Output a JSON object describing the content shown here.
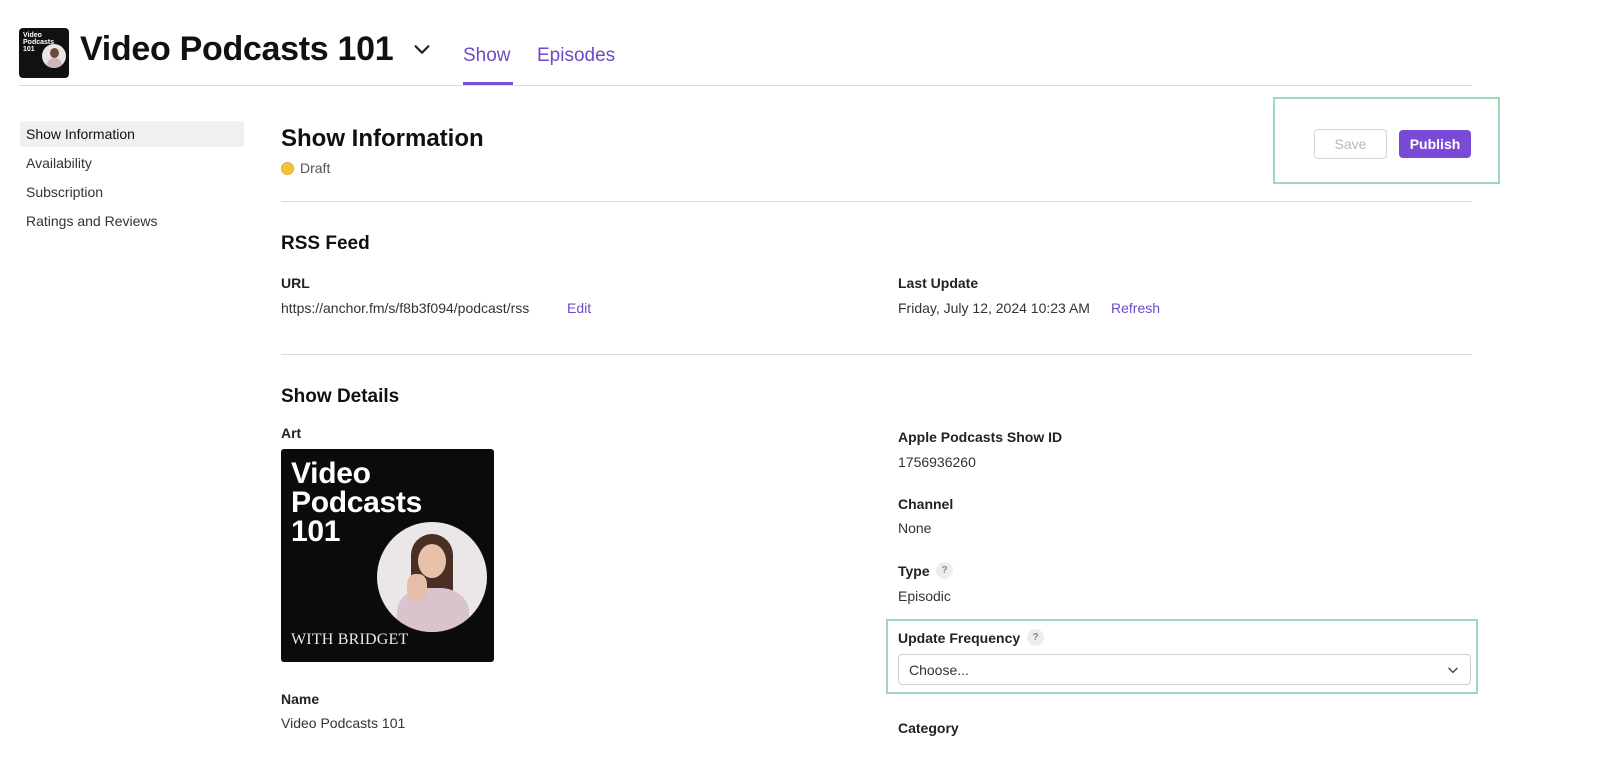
{
  "header": {
    "logo_text": "Video Podcasts 101",
    "show_title": "Video Podcasts 101",
    "tabs": [
      {
        "label": "Show",
        "active": true
      },
      {
        "label": "Episodes",
        "active": false
      }
    ]
  },
  "sidebar": {
    "items": [
      {
        "label": "Show Information",
        "active": true
      },
      {
        "label": "Availability",
        "active": false
      },
      {
        "label": "Subscription",
        "active": false
      },
      {
        "label": "Ratings and Reviews",
        "active": false
      }
    ]
  },
  "main": {
    "title": "Show Information",
    "status": "Draft",
    "actions": {
      "save_label": "Save",
      "publish_label": "Publish"
    },
    "rss": {
      "section_title": "RSS Feed",
      "url_label": "URL",
      "url_value": "https://anchor.fm/s/f8b3f094/podcast/rss",
      "edit_label": "Edit",
      "last_update_label": "Last Update",
      "last_update_value": "Friday, July 12, 2024 10:23 AM",
      "refresh_label": "Refresh"
    },
    "details": {
      "section_title": "Show Details",
      "art_label": "Art",
      "art_title": "Video Podcasts 101",
      "art_subtitle": "WITH BRIDGET",
      "name_label": "Name",
      "name_value": "Video Podcasts 101",
      "apple_id_label": "Apple Podcasts Show ID",
      "apple_id_value": "1756936260",
      "channel_label": "Channel",
      "channel_value": "None",
      "type_label": "Type",
      "type_value": "Episodic",
      "help_glyph": "?",
      "update_frequency_label": "Update Frequency",
      "update_frequency_value": "Choose...",
      "category_label": "Category"
    }
  },
  "colors": {
    "accent": "#7a4ad6",
    "link": "#6e49c9",
    "highlight": "#9ed8b4",
    "draft": "#f2c53d"
  },
  "icons": {
    "title_dropdown": "chevron-down-icon",
    "select_dropdown": "chevron-down-icon",
    "status": "status-dot-icon",
    "help": "help-icon"
  }
}
